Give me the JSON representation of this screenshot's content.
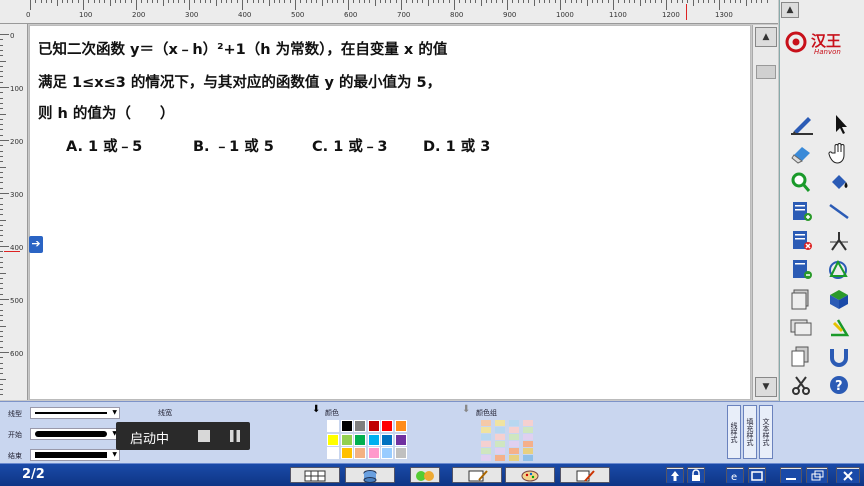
{
  "ruler": {
    "top_ticks": [
      "0",
      "100",
      "200",
      "300",
      "400",
      "500",
      "600",
      "700",
      "800",
      "900",
      "1000",
      "1100",
      "1200",
      "1300"
    ],
    "left_ticks": [
      "0",
      "100",
      "200",
      "300",
      "400",
      "500",
      "600"
    ]
  },
  "question": {
    "line1": "已知二次函数 y＝（x﹣h）²+1（h 为常数），在自变量 x 的值",
    "line2": "满足 1≤x≤3 的情况下，与其对应的函数值 y 的最小值为 5，",
    "line3": "则 h 的值为（　　）"
  },
  "options": [
    "A. 1 或﹣5",
    "B. ﹣1 或 5",
    "C. 1 或﹣3",
    "D. 1 或 3"
  ],
  "logo": {
    "cn": "汉王",
    "en": "Hanvon"
  },
  "bottom_toolbar": {
    "line_type_label": "线型",
    "start_label": "开始",
    "end_label": "结束",
    "line_width_label": "线宽",
    "color_label": "颜色",
    "color_group_label": "颜色组",
    "line_style_tab": "线样式",
    "fill_style_tab": "填充样式",
    "text_style_tab": "文本样式"
  },
  "popup": {
    "status": "启动中"
  },
  "status": {
    "page": "2/2"
  },
  "colors": {
    "accent": "#1a4aa8",
    "palette": [
      "#ffffff",
      "#000000",
      "#7f7f7f",
      "#c00000",
      "#ff0000",
      "#ff8c1a",
      "#ffff00",
      "#92d050",
      "#00b050",
      "#00b0f0",
      "#0070c0",
      "#7030a0",
      "#ffffff",
      "#ffc000",
      "#f4b183",
      "#ff99cc",
      "#99ccff",
      "#c0c0c0"
    ]
  },
  "icons": [
    "pen-icon",
    "pointer-icon",
    "eraser-icon",
    "hand-icon",
    "magnifier-icon",
    "fill-bucket-icon",
    "new-page-icon",
    "line-icon",
    "delete-page-icon",
    "compass-icon",
    "add-page-icon",
    "shape-icon",
    "page-list-icon",
    "cube-icon",
    "screen-icon",
    "angle-icon",
    "copy-icon",
    "magnet-icon",
    "scissors-icon",
    "help-icon",
    "tools-icon",
    "back-icon",
    "forward-icon"
  ]
}
